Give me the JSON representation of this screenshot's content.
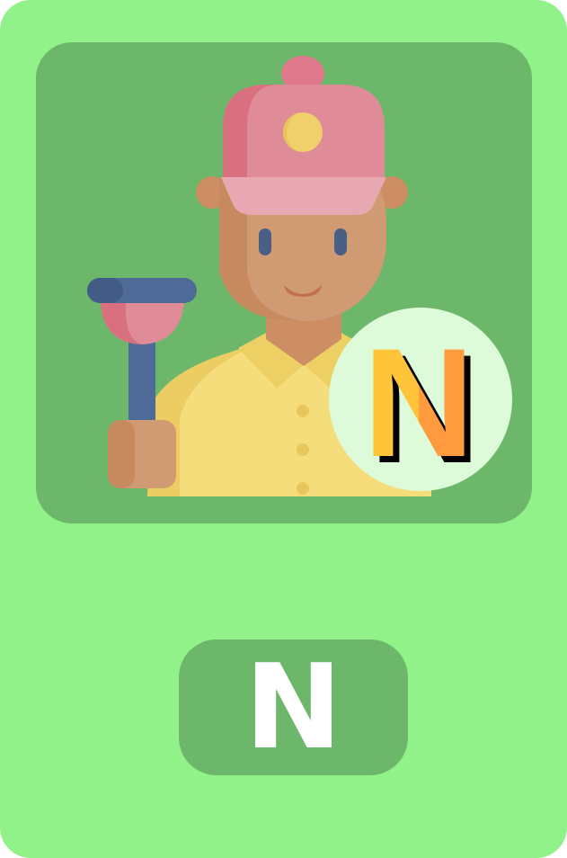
{
  "card": {
    "background_color": "#92f28a",
    "panel_color": "#6db76a"
  },
  "illustration": {
    "icon": "plumber-icon"
  },
  "badge": {
    "letter": "N",
    "circle_color": "#ddfbd9",
    "gradient": [
      "#ffc43a",
      "#ff9a3e"
    ]
  },
  "label": {
    "letter": "N",
    "text_color": "#ffffff"
  }
}
